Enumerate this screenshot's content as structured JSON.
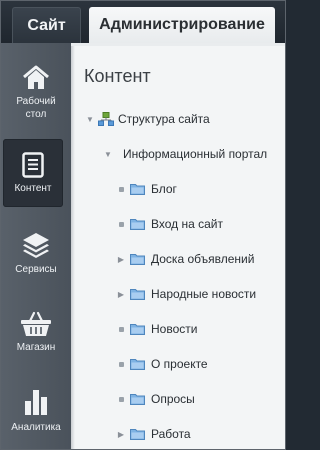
{
  "tabs": {
    "site": "Сайт",
    "admin": "Администрирование"
  },
  "sidebar": [
    {
      "label": "Рабочий стол",
      "icon": "home-icon"
    },
    {
      "label": "Контент",
      "icon": "document-icon"
    },
    {
      "label": "Сервисы",
      "icon": "layers-icon"
    },
    {
      "label": "Магазин",
      "icon": "basket-icon"
    },
    {
      "label": "Аналитика",
      "icon": "bar-chart-icon"
    }
  ],
  "content": {
    "title": "Контент",
    "tree": {
      "root": {
        "label": "Структура сайта",
        "icon": "site-structure-icon"
      },
      "portal": {
        "label": "Информационный портал"
      },
      "items": [
        {
          "label": "Блог"
        },
        {
          "label": "Вход на сайт"
        },
        {
          "label": "Доска объявлений"
        },
        {
          "label": "Народные новости"
        },
        {
          "label": "Новости"
        },
        {
          "label": "О проекте"
        },
        {
          "label": "Опросы"
        },
        {
          "label": "Работа"
        }
      ]
    }
  }
}
